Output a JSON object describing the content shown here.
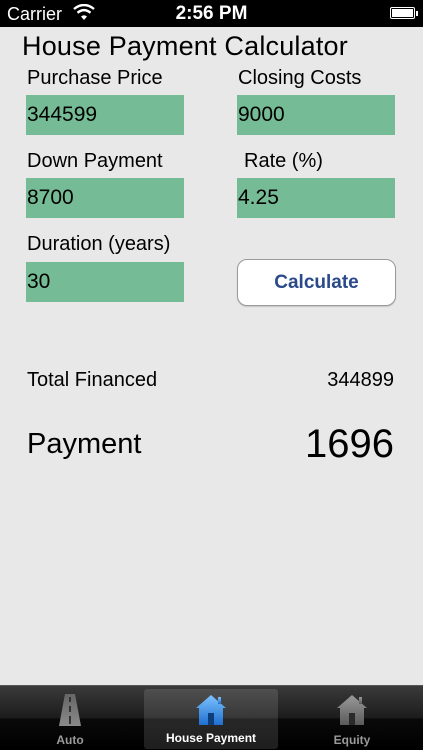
{
  "status_bar": {
    "carrier": "Carrier",
    "time": "2:56 PM"
  },
  "title": "House Payment Calculator",
  "form": {
    "purchase_price": {
      "label": "Purchase Price",
      "value": "344599"
    },
    "closing_costs": {
      "label": "Closing Costs",
      "value": "9000"
    },
    "down_payment": {
      "label": "Down Payment",
      "value": "8700"
    },
    "rate": {
      "label": "Rate (%)",
      "value": "4.25"
    },
    "duration": {
      "label": "Duration (years)",
      "value": "30"
    },
    "calculate_label": "Calculate"
  },
  "results": {
    "total_financed_label": "Total Financed",
    "total_financed_value": "344899",
    "payment_label": "Payment",
    "payment_value": "1696"
  },
  "tabs": [
    {
      "label": "Auto",
      "icon": "road-icon",
      "selected": false
    },
    {
      "label": "House Payment",
      "icon": "house-icon",
      "selected": true
    },
    {
      "label": "Equity",
      "icon": "house-icon",
      "selected": false
    }
  ],
  "colors": {
    "field_bg": "#75bb95",
    "button_text": "#2a4a8a",
    "tab_selected_icon": "#3a8de0"
  }
}
